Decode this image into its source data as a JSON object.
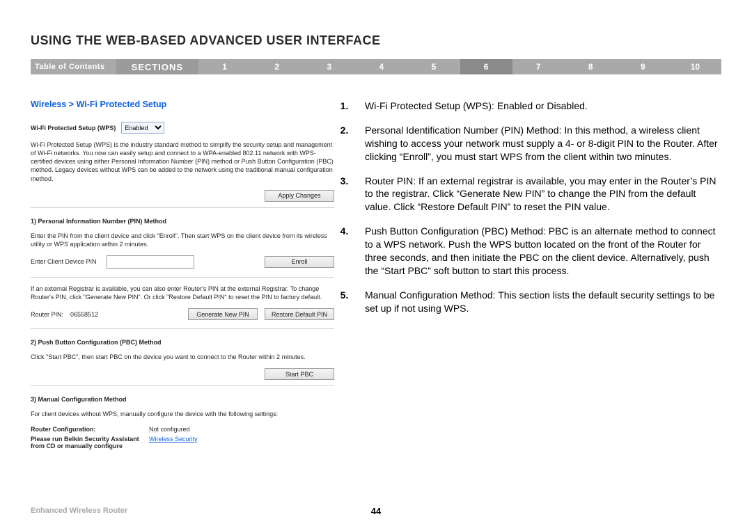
{
  "page_title": "USING THE WEB-BASED ADVANCED USER INTERFACE",
  "nav": {
    "toc": "Table of Contents",
    "sections": "SECTIONS",
    "numbers": [
      "1",
      "2",
      "3",
      "4",
      "5",
      "6",
      "7",
      "8",
      "9",
      "10"
    ],
    "active_index": 5
  },
  "breadcrumb": "Wireless > Wi-Fi Protected Setup",
  "panel": {
    "wps_label": "Wi-Fi Protected Setup (WPS)",
    "wps_value": "Enabled",
    "wps_desc": "Wi-Fi Protected Setup (WPS) is the industry standard method to simplify the security setup and management of Wi-Fi networks. You now can easily setup and connect to a WPA-enabled 802.11 network with WPS-certified devices using either Personal Information Number (PIN) method or Push Button Configuration (PBC) method. Legacy devices without WPS can be added to the network using the traditional manual configuration method.",
    "apply_changes": "Apply Changes",
    "pin_head": "1) Personal Information Number (PIN) Method",
    "pin_desc": "Enter the PIN from the client device and click \"Enroll\". Then start WPS on the client device from its wireless utility or WPS application within 2 minutes.",
    "enter_pin_label": "Enter Client Device PIN",
    "enroll": "Enroll",
    "registrar_desc": "If an external Registrar is available, you can also enter Router's PIN at the external Registrar. To change Router's PIN, click \"Generate New PIN\". Or click \"Restore Default PIN\" to reset the PIN to factory default.",
    "router_pin_label": "Router PIN:",
    "router_pin_value": "06558512",
    "gen_new_pin": "Generate New PIN",
    "restore_pin": "Restore Default PIN",
    "pbc_head": "2) Push Button Configuration (PBC) Method",
    "pbc_desc": "Click \"Start PBC\", then start PBC on the device you want to connect to the Router within 2 minutes.",
    "start_pbc": "Start PBC",
    "manual_head": "3) Manual Configuration Method",
    "manual_desc": "For client devices without WPS, manually configure the device with the following settings:",
    "router_config_k": "Router Configuration:",
    "router_config_v": "Not configured",
    "please_run_k": "Please run Belkin Security Assistant from CD or manually configure",
    "wireless_security_link": "Wireless Security"
  },
  "instructions": [
    "Wi-Fi Protected Setup (WPS): Enabled or Disabled.",
    "Personal Identification Number (PIN) Method: In this method, a wireless client wishing to access your network must supply a 4- or 8-digit PIN to the Router. After clicking “Enroll”, you must start WPS from the client within two minutes.",
    "Router PIN: If an external registrar is available, you may enter in the Router’s PIN to the registrar. Click “Generate New PIN” to change the PIN from the default value. Click “Restore Default PIN” to reset the PIN value.",
    "Push Button Configuration (PBC) Method: PBC is an alternate method to connect to a WPS network. Push the WPS button located on the front of the Router for three seconds, and then initiate the PBC on the client device. Alternatively, push the “Start PBC” soft button to start this process.",
    "Manual Configuration Method: This section lists the default security settings to be set up if not using WPS."
  ],
  "footer": {
    "left": "Enhanced Wireless Router",
    "page": "44"
  }
}
